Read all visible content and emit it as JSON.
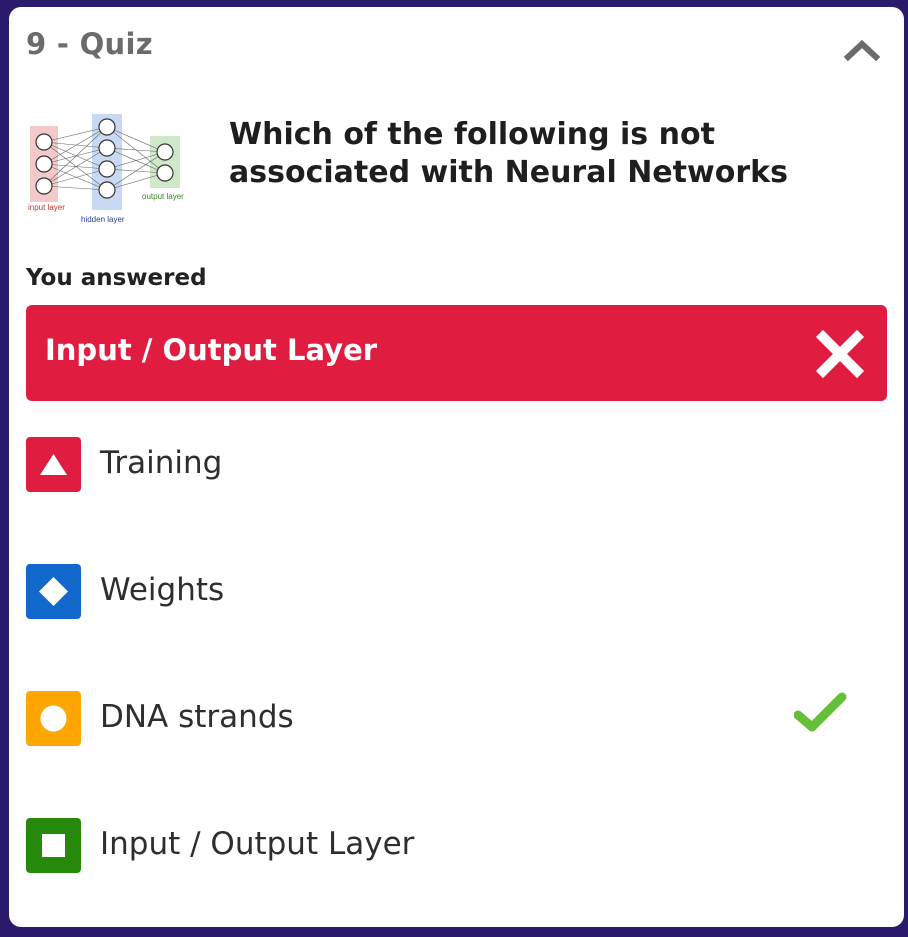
{
  "header": {
    "title": "9 - Quiz"
  },
  "question": {
    "text": "Which of the following is not associated with Neural Networks",
    "image": {
      "layers": {
        "input_label": "input layer",
        "hidden_label": "hidden layer",
        "output_label": "output layer"
      }
    }
  },
  "answered": {
    "heading": "You answered",
    "selected": "Input / Output Layer",
    "result_icon": "x-icon",
    "color": "#e01c40"
  },
  "options": [
    {
      "label": "Training",
      "shape": "triangle",
      "color": "#e01c40",
      "correct": false
    },
    {
      "label": "Weights",
      "shape": "diamond",
      "color": "#1368ce",
      "correct": false
    },
    {
      "label": "DNA strands",
      "shape": "circle",
      "color": "#ffa602",
      "correct": true
    },
    {
      "label": "Input / Output Layer",
      "shape": "square",
      "color": "#26890c",
      "correct": false
    }
  ],
  "colors": {
    "background": "#2a1a6b",
    "correct_check": "#66bf39"
  }
}
